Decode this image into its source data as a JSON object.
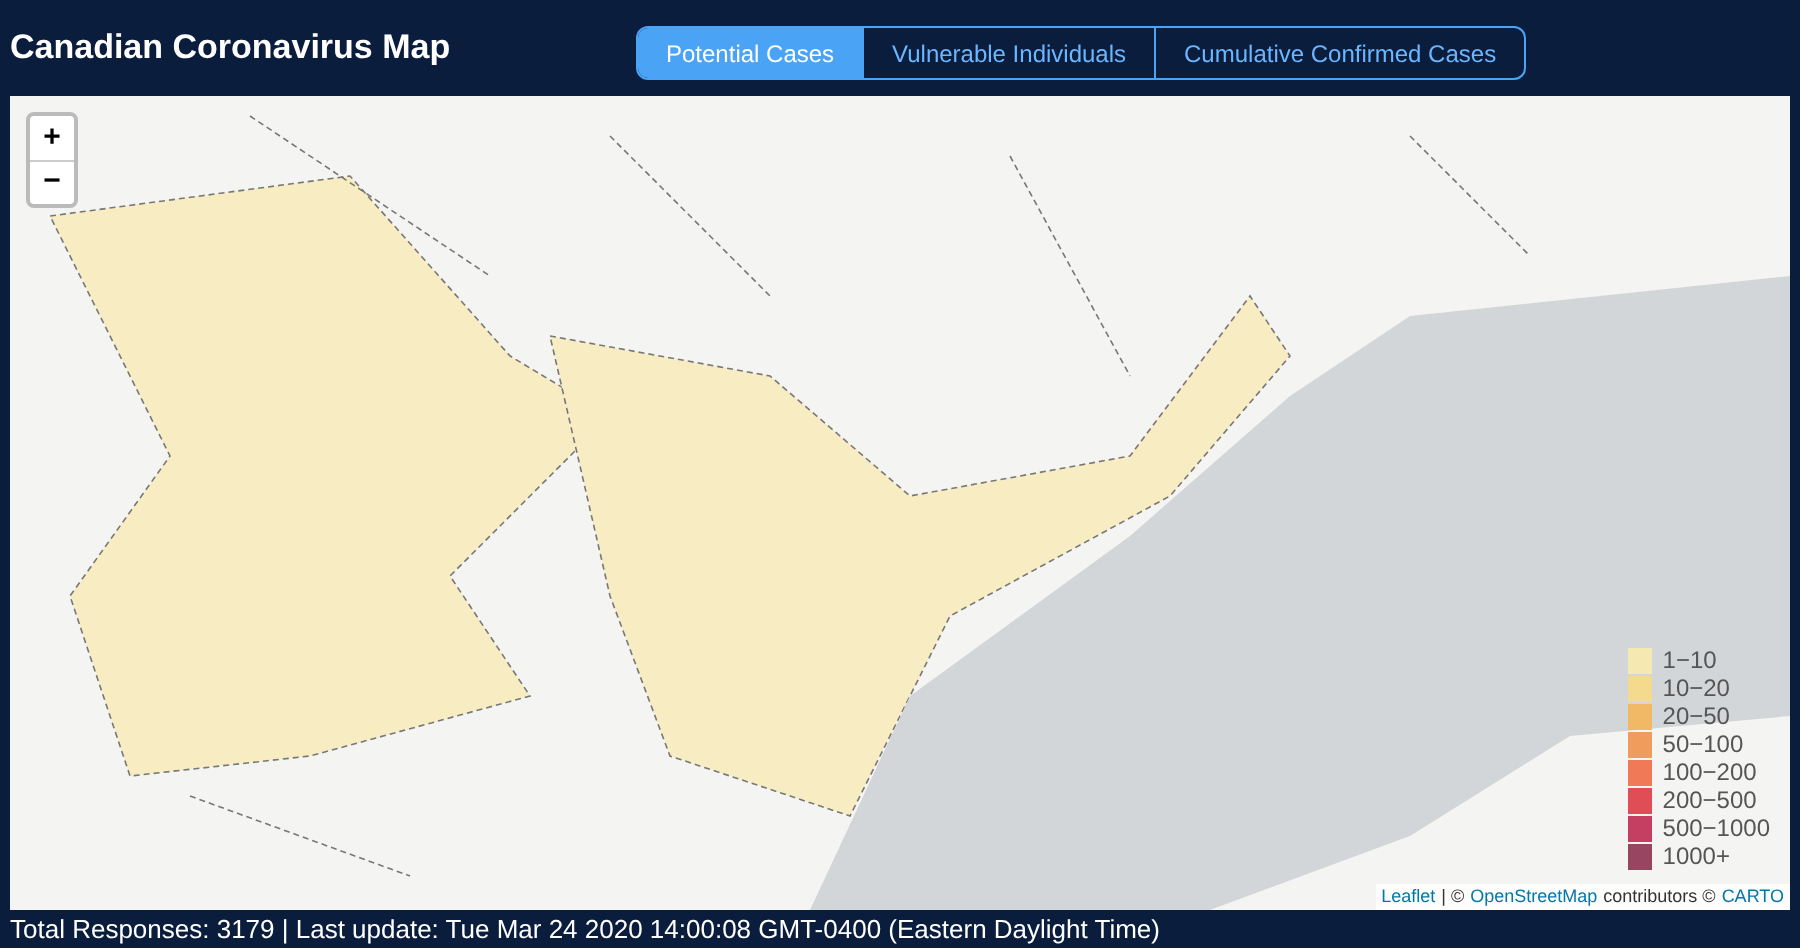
{
  "title": "Canadian Coronavirus Map",
  "tabs": [
    {
      "label": "Potential Cases",
      "selected": true
    },
    {
      "label": "Vulnerable Individuals",
      "selected": false
    },
    {
      "label": "Cumulative Confirmed Cases",
      "selected": false
    }
  ],
  "zoom_controls": [
    "+",
    "−"
  ],
  "legend": [
    {
      "label": "1−10",
      "color": "#f6e8b1"
    },
    {
      "label": "10−20",
      "color": "#f4da8c"
    },
    {
      "label": "20−50",
      "color": "#f1b865"
    },
    {
      "label": "50−100",
      "color": "#ef9c5c"
    },
    {
      "label": "100−200",
      "color": "#f07a58"
    },
    {
      "label": "200−500",
      "color": "#e14d57"
    },
    {
      "label": "500−1000",
      "color": "#c43f61"
    },
    {
      "label": "1000+",
      "color": "#984562"
    }
  ],
  "attribution": [
    {
      "text": "Leaflet",
      "kind": "link"
    },
    {
      "text": "| ©",
      "kind": "text"
    },
    {
      "text": "OpenStreetMap",
      "kind": "link"
    },
    {
      "text": "contributors ©",
      "kind": "text"
    },
    {
      "text": "CARTO",
      "kind": "link"
    }
  ],
  "status_bar": "Total Responses: 3179 | Last update: Tue Mar 24 2020 14:00:08 GMT-0400 (Eastern Daylight Time)"
}
